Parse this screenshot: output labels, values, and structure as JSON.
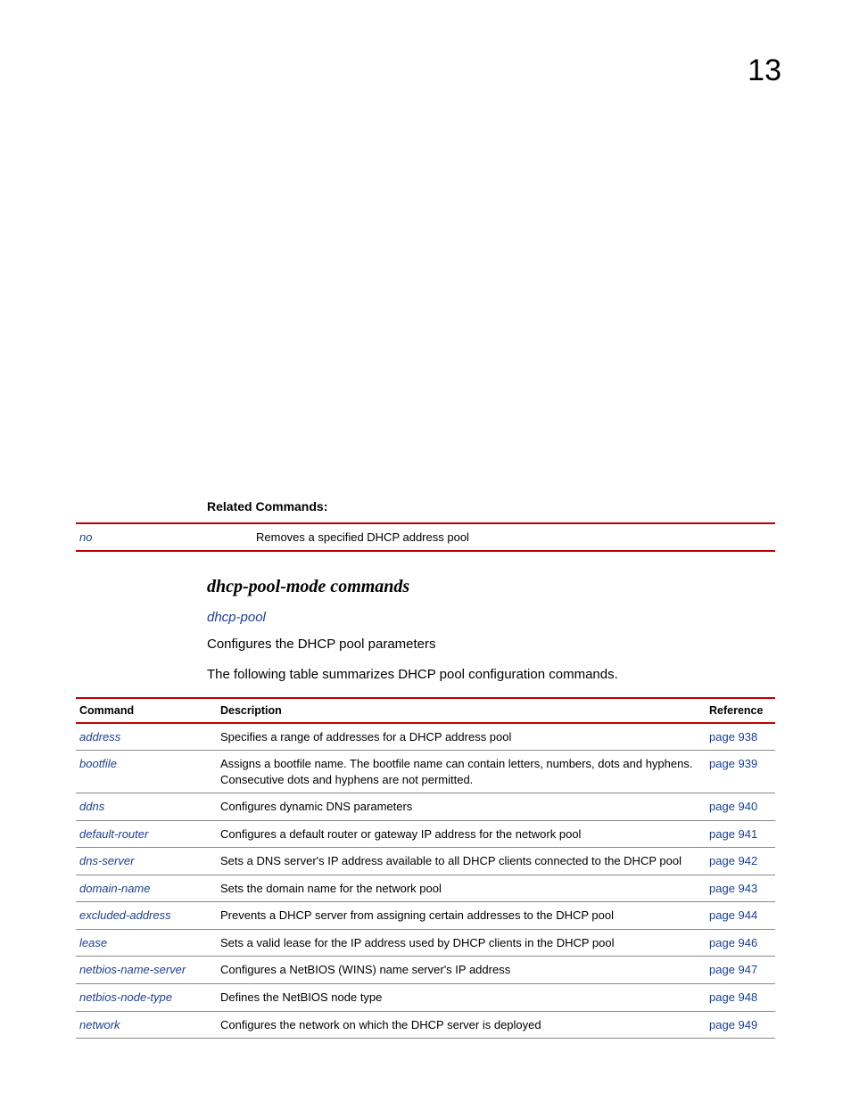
{
  "chapterNumber": "13",
  "relatedCommands": {
    "heading": "Related Commands:",
    "rows": [
      {
        "cmd": "no",
        "desc": "Removes a specified DHCP address pool"
      }
    ]
  },
  "section": {
    "title": "dhcp-pool-mode commands",
    "subLink": "dhcp-pool",
    "paragraphs": [
      "Configures the DHCP pool parameters",
      "The following table summarizes DHCP pool configuration commands."
    ]
  },
  "commandTable": {
    "headers": {
      "cmd": "Command",
      "desc": "Description",
      "ref": "Reference"
    },
    "rows": [
      {
        "cmd": "address",
        "desc": "Specifies a range of addresses for a DHCP address pool",
        "ref": "page 938"
      },
      {
        "cmd": "bootfile",
        "desc": "Assigns a bootfile name. The bootfile name can contain letters, numbers, dots and hyphens. Consecutive dots and hyphens are not permitted.",
        "ref": "page 939"
      },
      {
        "cmd": "ddns",
        "desc": "Configures dynamic DNS parameters",
        "ref": "page 940"
      },
      {
        "cmd": "default-router",
        "desc": "Configures a default router or gateway IP address for the network pool",
        "ref": "page 941"
      },
      {
        "cmd": "dns-server",
        "desc": "Sets a DNS server's IP address available to all DHCP clients connected to the DHCP pool",
        "ref": "page 942"
      },
      {
        "cmd": "domain-name",
        "desc": "Sets the domain name for the network pool",
        "ref": "page 943"
      },
      {
        "cmd": "excluded-address",
        "desc": "Prevents a DHCP server from assigning certain addresses to the DHCP pool",
        "ref": "page 944"
      },
      {
        "cmd": "lease",
        "desc": "Sets a valid lease for the IP address used by DHCP clients in the DHCP pool",
        "ref": "page 946"
      },
      {
        "cmd": "netbios-name-server",
        "desc": "Configures a NetBIOS (WINS) name server's IP address",
        "ref": "page 947"
      },
      {
        "cmd": "netbios-node-type",
        "desc": "Defines the NetBIOS node type",
        "ref": "page 948"
      },
      {
        "cmd": "network",
        "desc": "Configures the network on which the DHCP server is deployed",
        "ref": "page 949"
      }
    ]
  }
}
